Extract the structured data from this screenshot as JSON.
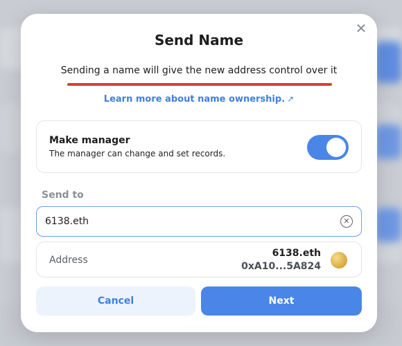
{
  "modal": {
    "title": "Send Name",
    "warning": "Sending a name will give the new address control over it",
    "learn_more": "Learn more about name ownership.",
    "close_icon": "close-icon"
  },
  "manager": {
    "title": "Make manager",
    "description": "The manager can change and set records.",
    "toggle_on": true
  },
  "send_to": {
    "label": "Send to",
    "value": "6138.eth",
    "clear_icon": "clear-icon"
  },
  "address": {
    "label": "Address",
    "name": "6138.eth",
    "hex": "0xA10...5A824"
  },
  "actions": {
    "cancel": "Cancel",
    "next": "Next"
  },
  "colors": {
    "accent": "#4a86e8",
    "warning_underline": "#d4432f",
    "link": "#3f7fe0"
  }
}
